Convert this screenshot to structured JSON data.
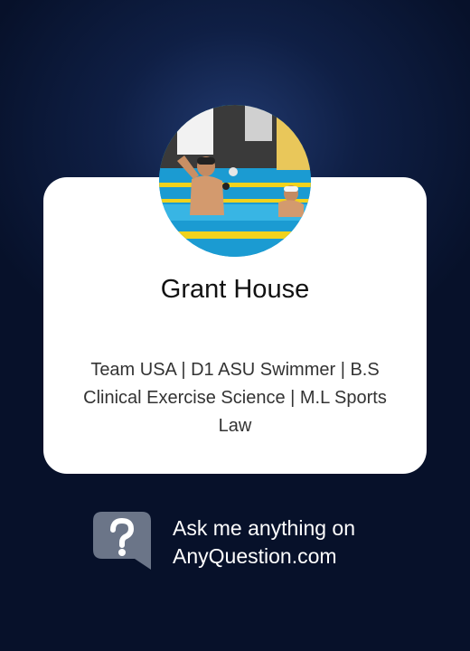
{
  "profile": {
    "name": "Grant House",
    "bio": "Team USA | D1 ASU Swimmer | B.S Clinical Exercise Science | M.L Sports Law",
    "avatar_icon": "profile-photo-swimmer"
  },
  "promo": {
    "line1": "Ask me anything on",
    "line2": "AnyQuestion.com",
    "logo_icon": "question-mark-logo"
  },
  "colors": {
    "background": "#0b1836",
    "card": "#ffffff",
    "logo": "#6b7588"
  }
}
